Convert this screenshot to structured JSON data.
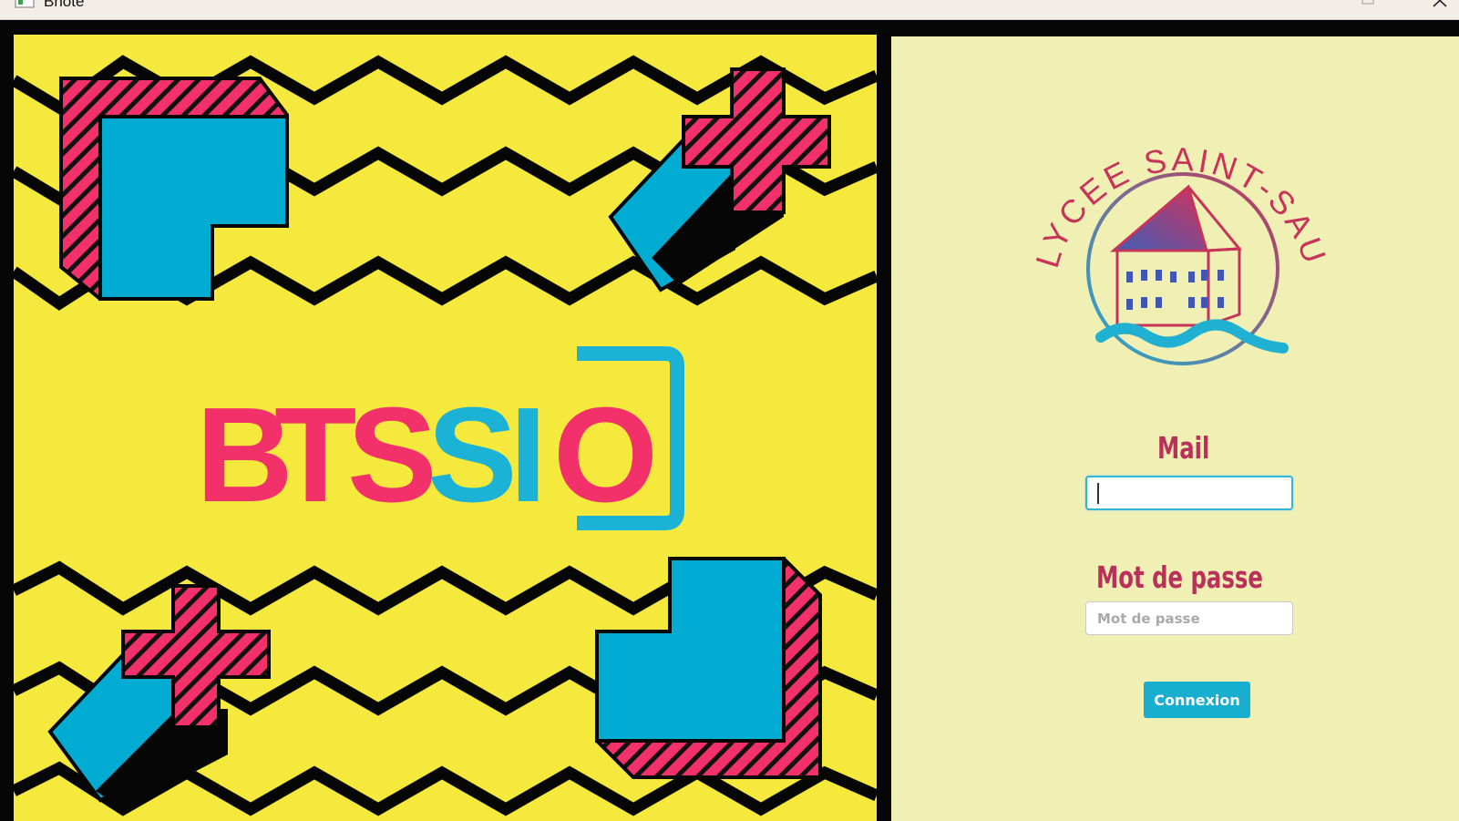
{
  "window": {
    "title": "Bnote",
    "app_icon": "window-app-icon",
    "controls": [
      "maximize-icon",
      "close-icon"
    ]
  },
  "art": {
    "logo_letters": [
      {
        "text": "B",
        "color": "#f2316a"
      },
      {
        "text": "T",
        "color": "#f2316a"
      },
      {
        "text": "S",
        "color": "#f2316a"
      },
      {
        "text": "S",
        "color": "#1cb2d6"
      },
      {
        "text": "I",
        "color": "#1cb2d6"
      },
      {
        "text": "O",
        "color": "#f2316a"
      }
    ],
    "colors": {
      "background": "#f4e93c",
      "pink": "#f2316a",
      "blue": "#00acd2",
      "black": "#060606"
    }
  },
  "school": {
    "name": "LYCEE SAINT-SAUVEUR",
    "colors": {
      "pink": "#c73359",
      "blue": "#1fb0d2"
    }
  },
  "login": {
    "mail_label": "Mail",
    "mail_value": "",
    "password_label": "Mot de passe",
    "password_placeholder": "Mot de passe",
    "submit_label": "Connexion"
  }
}
